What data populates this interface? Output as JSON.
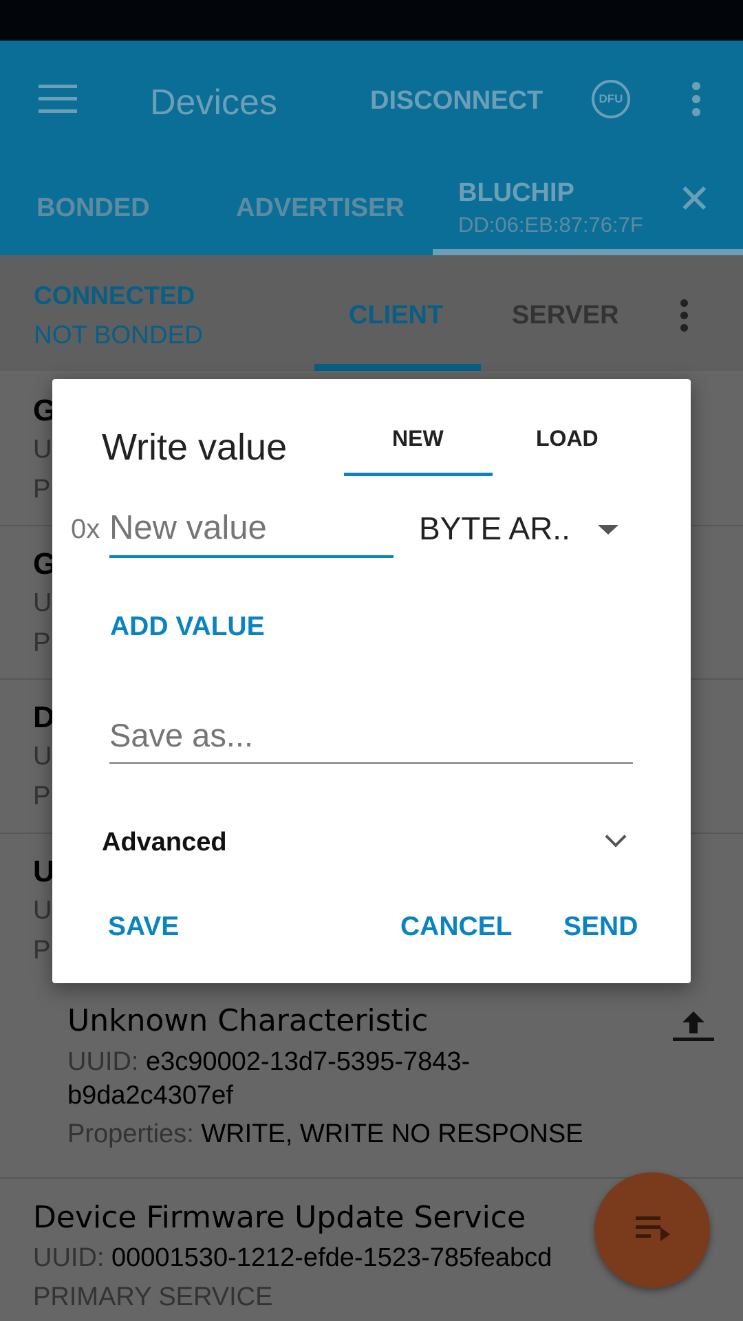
{
  "app_bar": {
    "title": "Devices",
    "disconnect": "DISCONNECT",
    "dfu_label": "DFU"
  },
  "tabs": {
    "bonded": "BONDED",
    "advertiser": "ADVERTISER",
    "device_name": "BLUCHIP",
    "device_mac": "DD:06:EB:87:76:7F"
  },
  "connection": {
    "state": "CONNECTED",
    "bond_state": "NOT BONDED",
    "client_tab": "CLIENT",
    "server_tab": "SERVER"
  },
  "list": {
    "partial_rows": [
      {
        "t": "G",
        "u": "U",
        "p": "P"
      },
      {
        "t": "G",
        "u": "U",
        "p": "P"
      },
      {
        "t": "D",
        "u": "U",
        "p": "P"
      },
      {
        "t": "U",
        "u": "U",
        "p": "P"
      }
    ],
    "characteristic": {
      "name": "Unknown Characteristic",
      "uuid_label": "UUID:",
      "uuid_1": "e3c90002-13d7-5395-7843-",
      "uuid_2": "b9da2c4307ef",
      "props_label": "Properties:",
      "props": "WRITE, WRITE NO RESPONSE"
    },
    "service": {
      "name": "Device Firmware Update Service",
      "uuid_label": "UUID:",
      "uuid": "00001530-1212-efde-1523-785feabcd",
      "type": "PRIMARY SERVICE"
    }
  },
  "dialog": {
    "title": "Write value",
    "tab_new": "NEW",
    "tab_load": "LOAD",
    "prefix": "0x",
    "value": "",
    "value_placeholder": "New value",
    "format": "BYTE AR..",
    "add_value": "ADD VALUE",
    "save_as": "",
    "save_as_placeholder": "Save as...",
    "advanced": "Advanced",
    "save": "SAVE",
    "cancel": "CANCEL",
    "send": "SEND"
  },
  "colors": {
    "app_bar": "#0b6e96",
    "accent": "#0a84c1",
    "fab": "#7a3a1c"
  }
}
